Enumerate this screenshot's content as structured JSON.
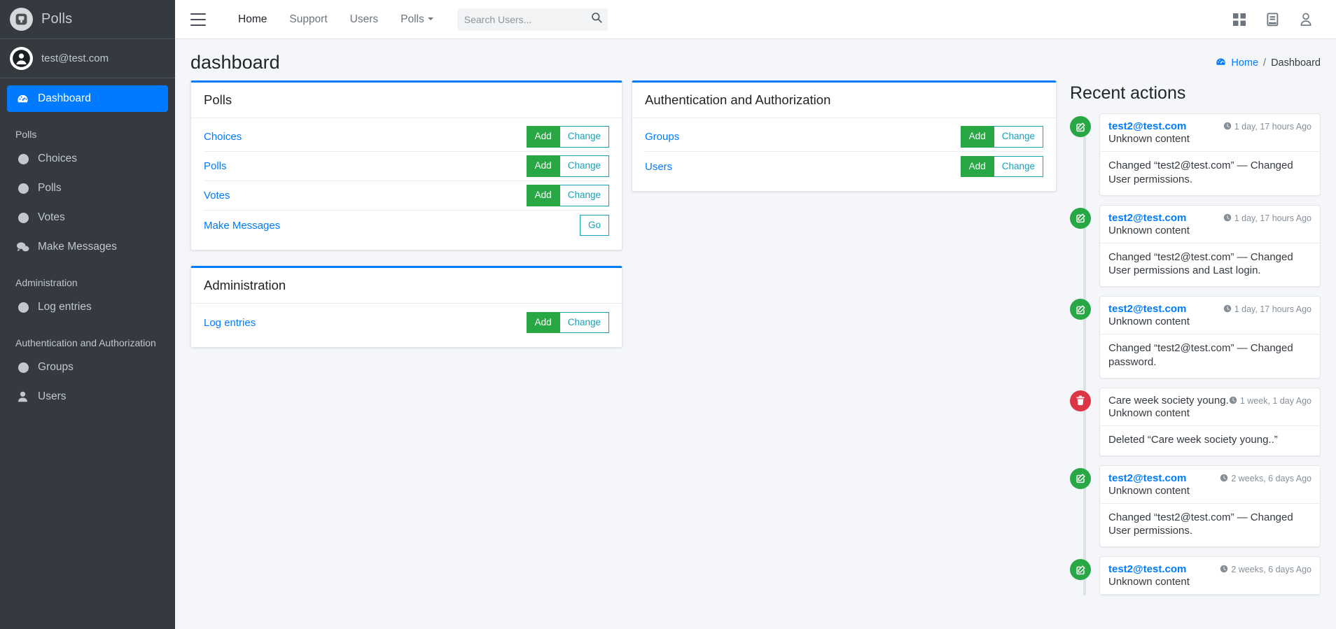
{
  "sidebar": {
    "brand": {
      "title": "Polls",
      "logo_icon": "polls-logo-icon"
    },
    "user": {
      "email": "test@test.com",
      "avatar_icon": "user-avatar-icon"
    },
    "dashboard": {
      "label": "Dashboard",
      "icon": "gauge-icon"
    },
    "sections": [
      {
        "header": "Polls",
        "items": [
          {
            "label": "Choices",
            "icon": "circle-icon"
          },
          {
            "label": "Polls",
            "icon": "circle-icon"
          },
          {
            "label": "Votes",
            "icon": "circle-icon"
          },
          {
            "label": "Make Messages",
            "icon": "comments-icon"
          }
        ]
      },
      {
        "header": "Administration",
        "items": [
          {
            "label": "Log entries",
            "icon": "circle-icon"
          }
        ]
      },
      {
        "header": "Authentication and Authorization",
        "items": [
          {
            "label": "Groups",
            "icon": "circle-icon"
          },
          {
            "label": "Users",
            "icon": "user-icon"
          }
        ]
      }
    ]
  },
  "topnav": {
    "menu_icon": "hamburger-icon",
    "links": [
      {
        "label": "Home",
        "active": true
      },
      {
        "label": "Support",
        "active": false
      },
      {
        "label": "Users",
        "active": false
      },
      {
        "label": "Polls",
        "active": false,
        "has_caret": true
      }
    ],
    "search": {
      "placeholder": "Search Users...",
      "value": "",
      "icon": "search-icon"
    },
    "right_icons": [
      {
        "name": "apps-grid-icon"
      },
      {
        "name": "book-icon"
      },
      {
        "name": "user-account-icon"
      }
    ]
  },
  "content_header": {
    "title": "dashboard",
    "breadcrumb": {
      "home_icon": "gauge-icon",
      "home": "Home",
      "separator": "/",
      "current": "Dashboard"
    }
  },
  "cards": [
    {
      "title": "Polls",
      "rows": [
        {
          "label": "Choices",
          "add": "Add",
          "change": "Change"
        },
        {
          "label": "Polls",
          "add": "Add",
          "change": "Change"
        },
        {
          "label": "Votes",
          "add": "Add",
          "change": "Change"
        },
        {
          "label": "Make Messages",
          "go": "Go"
        }
      ]
    },
    {
      "title": "Administration",
      "rows": [
        {
          "label": "Log entries",
          "add": "Add",
          "change": "Change"
        }
      ]
    },
    {
      "title": "Authentication and Authorization",
      "rows": [
        {
          "label": "Groups",
          "add": "Add",
          "change": "Change"
        },
        {
          "label": "Users",
          "add": "Add",
          "change": "Change"
        }
      ]
    }
  ],
  "recent_actions": {
    "title": "Recent actions",
    "items": [
      {
        "type": "edit",
        "icon": "edit-icon",
        "user": "test2@test.com",
        "is_link": true,
        "content": "Unknown content",
        "time": "1 day, 17 hours Ago",
        "time_icon": "clock-icon",
        "body": "Changed “test2@test.com” — Changed User permissions."
      },
      {
        "type": "edit",
        "icon": "edit-icon",
        "user": "test2@test.com",
        "is_link": true,
        "content": "Unknown content",
        "time": "1 day, 17 hours Ago",
        "time_icon": "clock-icon",
        "body": "Changed “test2@test.com” — Changed User permissions and Last login."
      },
      {
        "type": "edit",
        "icon": "edit-icon",
        "user": "test2@test.com",
        "is_link": true,
        "content": "Unknown content",
        "time": "1 day, 17 hours Ago",
        "time_icon": "clock-icon",
        "body": "Changed “test2@test.com” — Changed password."
      },
      {
        "type": "delete",
        "icon": "trash-icon",
        "user": "Care week society young.",
        "is_link": false,
        "content": "Unknown content",
        "time": "1 week, 1 day Ago",
        "time_icon": "clock-icon",
        "body": "Deleted “Care week society young..”"
      },
      {
        "type": "edit",
        "icon": "edit-icon",
        "user": "test2@test.com",
        "is_link": true,
        "content": "Unknown content",
        "time": "2 weeks, 6 days Ago",
        "time_icon": "clock-icon",
        "body": "Changed “test2@test.com” — Changed User permissions."
      },
      {
        "type": "edit",
        "icon": "edit-icon",
        "user": "test2@test.com",
        "is_link": true,
        "content": "Unknown content",
        "time": "2 weeks, 6 days Ago",
        "time_icon": "clock-icon",
        "body": ""
      }
    ]
  },
  "colors": {
    "sidebar_bg": "#343a40",
    "accent_blue": "#007bff",
    "add_green": "#28a745",
    "change_teal": "#17a2b8",
    "delete_red": "#dc3545",
    "page_bg": "#f4f6f9"
  }
}
